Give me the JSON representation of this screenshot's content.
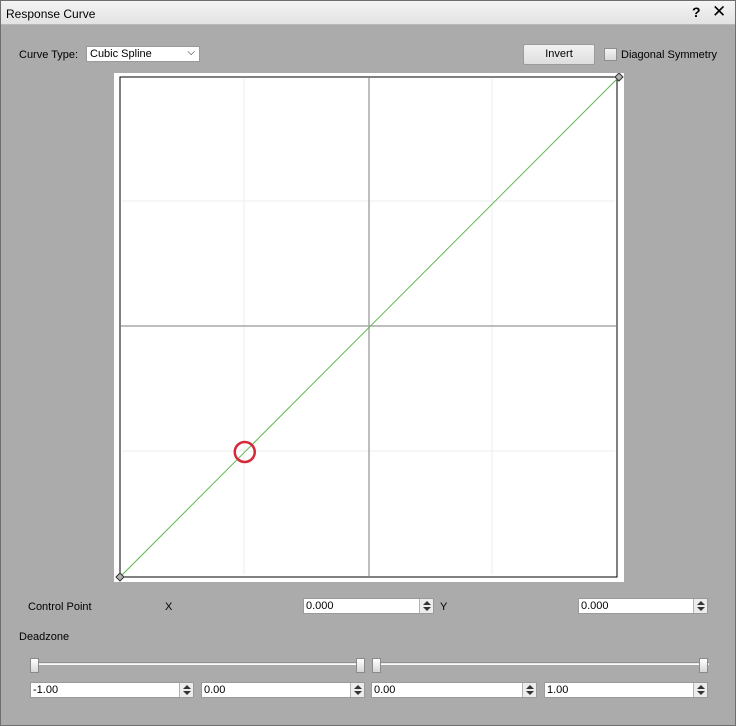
{
  "window": {
    "title": "Response Curve",
    "help": "?",
    "close": "✕"
  },
  "toolbar": {
    "curve_type_label": "Curve Type:",
    "curve_type_value": "Cubic Spline",
    "invert_label": "Invert",
    "diagonal_symmetry_label": "Diagonal Symmetry",
    "diagonal_symmetry_checked": false
  },
  "curve": {
    "line_color": "#5fb84e",
    "x_range": [
      -1,
      1
    ],
    "y_range": [
      -1,
      1
    ],
    "points": [
      {
        "x": -1,
        "y": -1
      },
      {
        "x": 1,
        "y": 1
      }
    ],
    "selected_point": {
      "x": -0.5,
      "y": -0.5,
      "color": "#d42a3a"
    }
  },
  "control_point": {
    "label": "Control Point",
    "x_label": "X",
    "x_value": "0.000",
    "y_label": "Y",
    "y_value": "0.000"
  },
  "deadzone": {
    "label": "Deadzone",
    "sliders": [
      {
        "min_fraction": 0.0,
        "max_fraction": 1.0
      },
      {
        "min_fraction": 0.0,
        "max_fraction": 1.0
      }
    ],
    "values": [
      "-1.00",
      "0.00",
      "0.00",
      "1.00"
    ]
  }
}
